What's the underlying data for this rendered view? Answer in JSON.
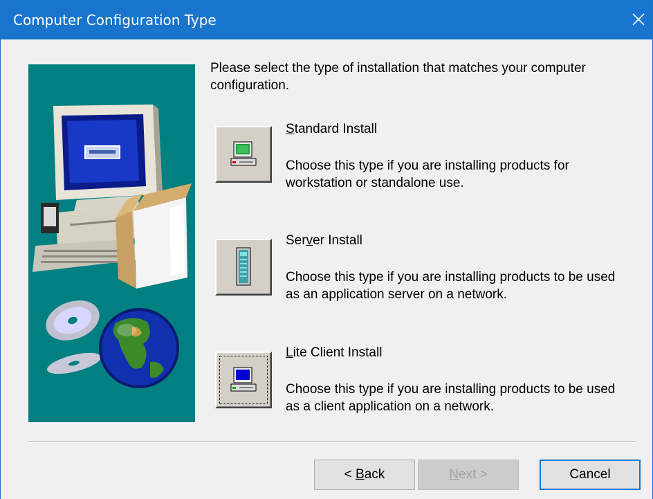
{
  "window": {
    "title": "Computer Configuration Type",
    "titlebar_color": "#1874cd",
    "panel_color": "#008080"
  },
  "intro": "Please select the type of installation that matches your computer configuration.",
  "options": [
    {
      "title_mnemonic": "S",
      "title_rest": "tandard Install",
      "description": "Choose this type if you are installing products for workstation or standalone use.",
      "icon": "workstation-icon"
    },
    {
      "title_pre": "Ser",
      "title_mnemonic": "v",
      "title_rest": "er Install",
      "description": "Choose this type if you are installing products to be used as an application server on a network.",
      "icon": "server-icon"
    },
    {
      "title_mnemonic": "L",
      "title_rest": "ite Client Install",
      "description": "Choose this type if you are installing products to be used as a client application on a network.",
      "icon": "client-computer-icon"
    }
  ],
  "buttons": {
    "back_prefix": "< ",
    "back_mnemonic": "B",
    "back_rest": "ack",
    "next_mnemonic": "N",
    "next_rest": "ext >",
    "cancel": "Cancel"
  }
}
